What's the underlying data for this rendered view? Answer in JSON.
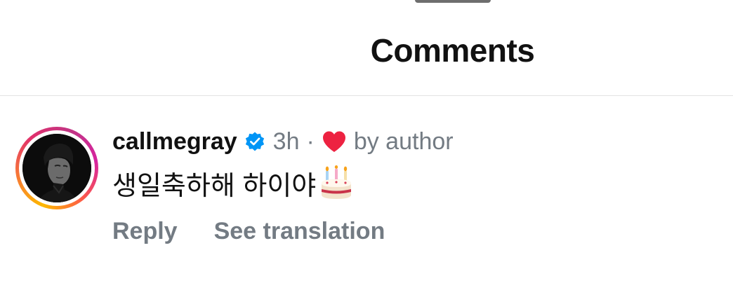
{
  "header": {
    "title": "Comments"
  },
  "comment": {
    "username": "callmegray",
    "verified": true,
    "time": "3h",
    "separator": "·",
    "liked_by_author_label": "by author",
    "text": "생일축하해 하이야",
    "emoji": "birthday-cake",
    "actions": {
      "reply_label": "Reply",
      "see_translation_label": "See translation"
    }
  },
  "colors": {
    "verified_badge": "#0095f6",
    "heart": "#ed2241",
    "meta_text": "#737b83",
    "divider": "#e3e3e3"
  }
}
